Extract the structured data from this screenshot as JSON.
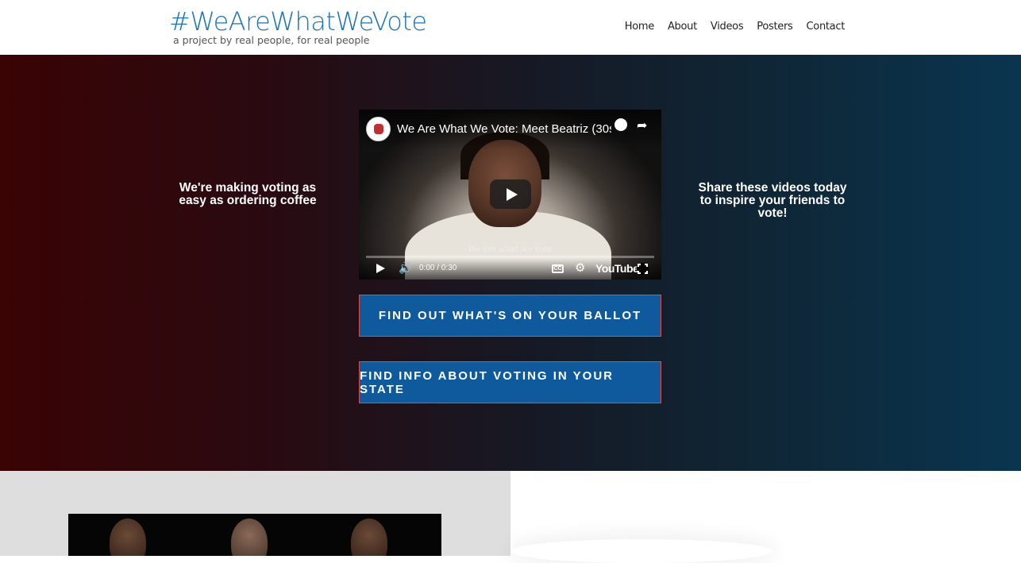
{
  "header": {
    "title": "#WeAreWhatWeVote",
    "subtitle": "a project by real people, for real people",
    "nav": [
      "Home",
      "About",
      "Videos",
      "Posters",
      "Contact"
    ]
  },
  "hero": {
    "left_text": "We're making voting as easy as ordering coffee",
    "right_text": "Share these videos today to inspire your friends to vote!",
    "video": {
      "title": "We Are What We Vote: Meet Beatriz (30se...",
      "caption": "We are what we vote",
      "time": "0:00 / 0:30",
      "cc_label": "CC",
      "brand": "YouTube"
    },
    "buttons": {
      "ballot": "FIND OUT WHAT'S ON YOUR BALLOT",
      "state": "FIND INFO ABOUT VOTING IN YOUR STATE"
    }
  },
  "colors": {
    "brand": "#1a75bb",
    "button": "#0e5a9c",
    "button_border": "#d45050"
  }
}
